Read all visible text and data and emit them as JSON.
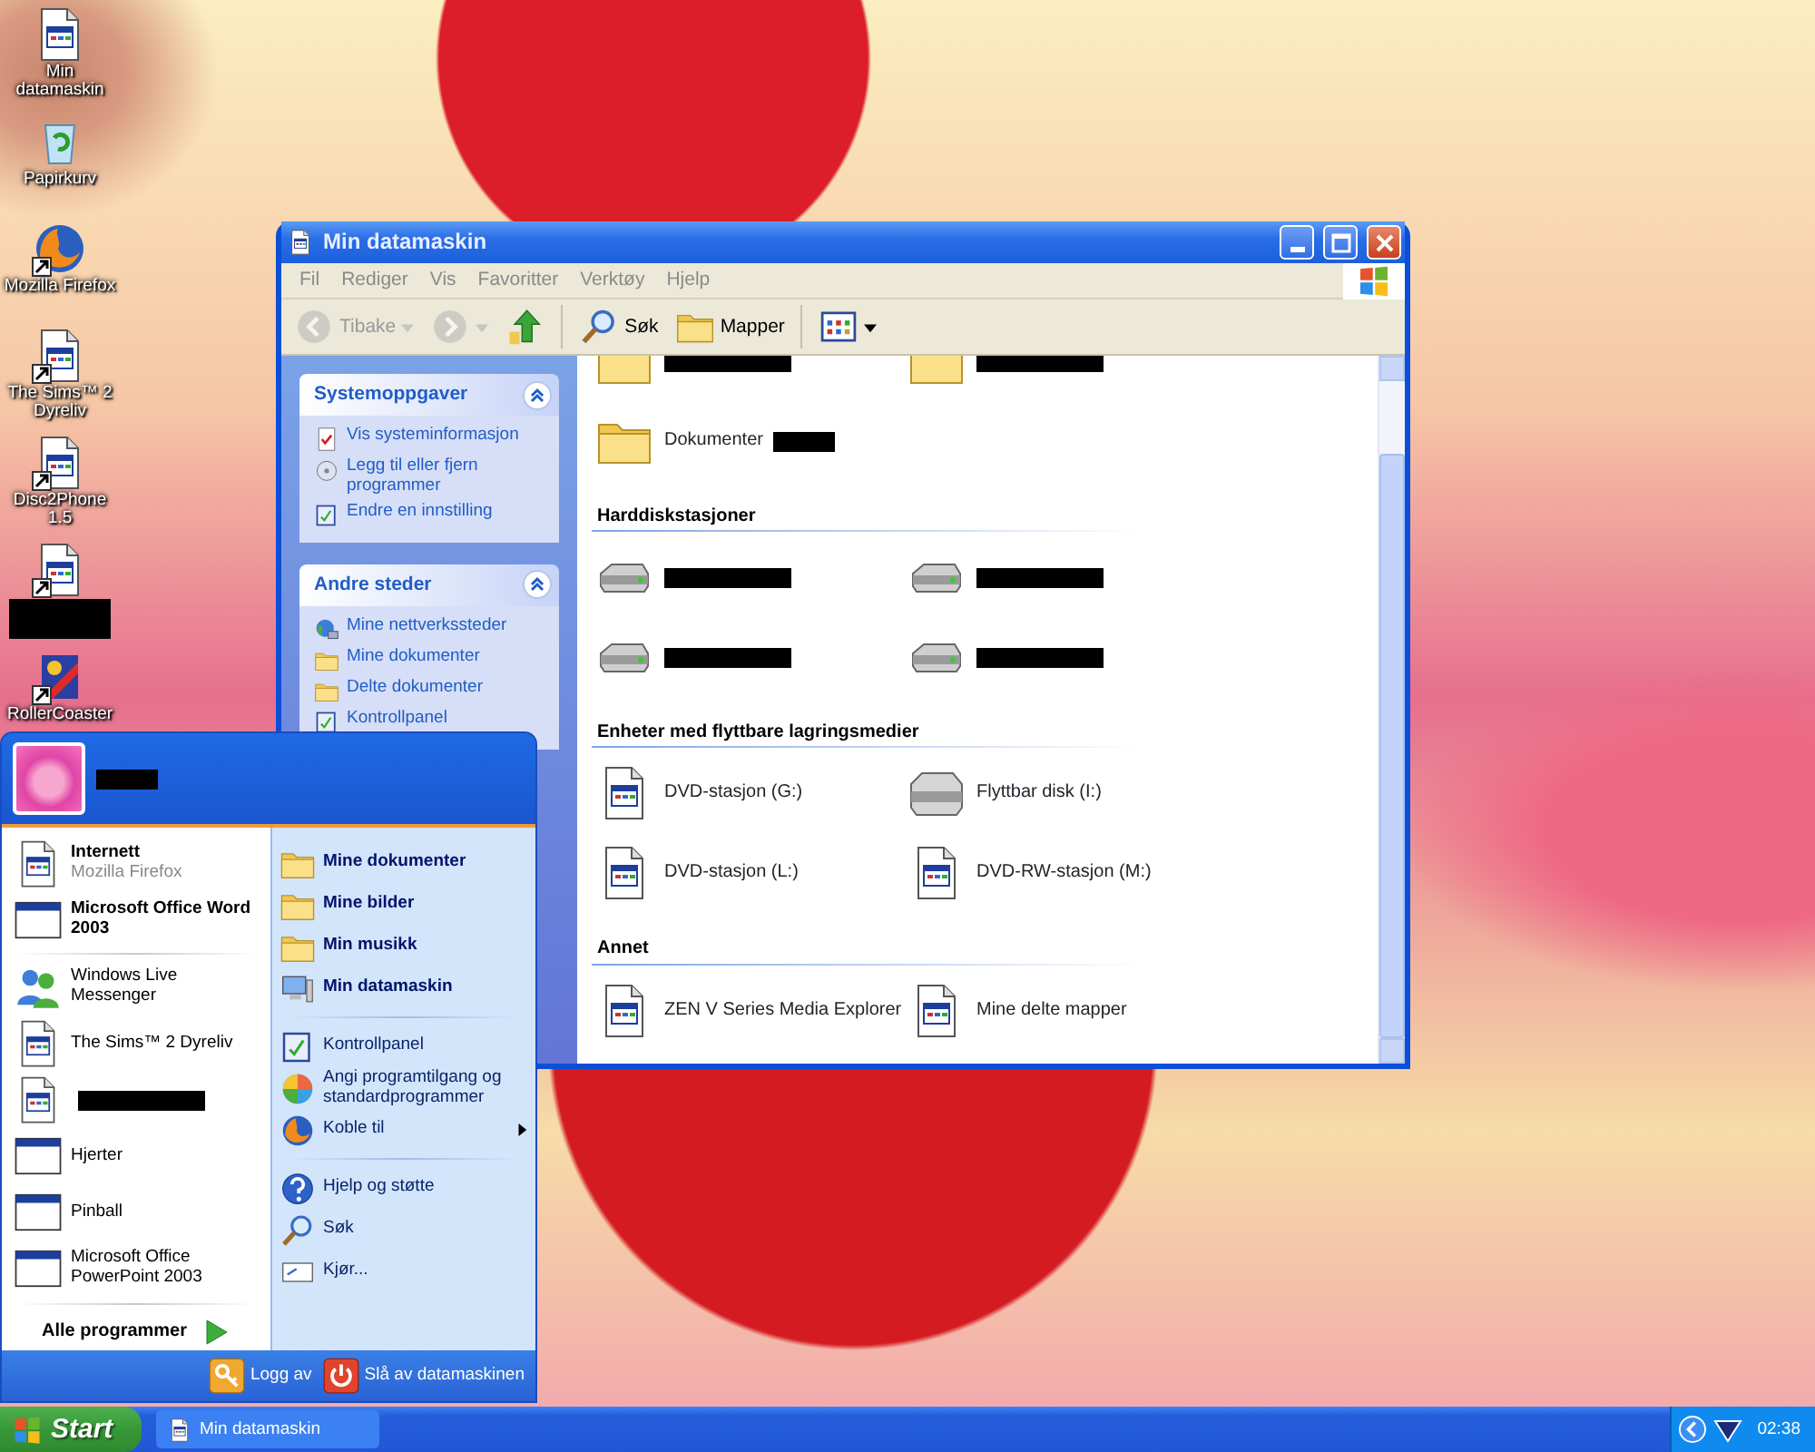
{
  "desktop_icons": [
    {
      "label": "Min datamaskin",
      "kind": "program",
      "shortcut": false
    },
    {
      "label": "Papirkurv",
      "kind": "recycle",
      "shortcut": false
    },
    {
      "label": "Mozilla Firefox",
      "kind": "firefox",
      "shortcut": true
    },
    {
      "label": "The Sims™ 2 Dyreliv",
      "kind": "program",
      "shortcut": true
    },
    {
      "label": "Disc2Phone 1.5",
      "kind": "program",
      "shortcut": true
    },
    {
      "kind": "program",
      "shortcut": true,
      "redacted": true
    },
    {
      "label": "RollerCoaster",
      "kind": "coaster",
      "shortcut": true
    }
  ],
  "window": {
    "title": "Min datamaskin",
    "menu": [
      "Fil",
      "Rediger",
      "Vis",
      "Favoritter",
      "Verktøy",
      "Hjelp"
    ],
    "toolbar": [
      {
        "kind": "back",
        "label": "Tibake",
        "disabled": true
      },
      {
        "kind": "forward",
        "disabled": true
      },
      {
        "kind": "up",
        "disabled": false
      },
      {
        "kind": "search",
        "label": "Søk",
        "disabled": false
      },
      {
        "kind": "folders",
        "label": "Mapper",
        "disabled": false
      },
      {
        "kind": "views",
        "disabled": false
      }
    ],
    "task_panels": [
      {
        "title": "Systemoppgaver",
        "expanded": true,
        "links": [
          {
            "kind": "info",
            "label": "Vis systeminformasjon"
          },
          {
            "kind": "disc",
            "label": "Legg til eller fjern programmer"
          },
          {
            "kind": "cpanel",
            "label": "Endre en innstilling"
          }
        ]
      },
      {
        "title": "Andre steder",
        "expanded": true,
        "links": [
          {
            "kind": "network",
            "label": "Mine nettverkssteder"
          },
          {
            "kind": "folder",
            "label": "Mine dokumenter"
          },
          {
            "kind": "folder",
            "label": "Delte dokumenter"
          },
          {
            "kind": "cpanel",
            "label": "Kontrollpanel"
          }
        ]
      }
    ],
    "sections": [
      {
        "items": [
          {
            "kind": "folder",
            "redacted": true
          },
          {
            "kind": "folder",
            "redacted": true
          },
          {
            "kind": "folder",
            "label": "Dokumenter",
            "redacted": true
          }
        ]
      },
      {
        "title": "Harddiskstasjoner",
        "items": [
          {
            "kind": "drive",
            "redacted": true
          },
          {
            "kind": "drive",
            "redacted": true
          },
          {
            "kind": "drive",
            "redacted": true
          },
          {
            "kind": "drive",
            "redacted": true
          }
        ]
      },
      {
        "title": "Enheter med flyttbare lagringsmedier",
        "items": [
          {
            "kind": "program",
            "label": "DVD-stasjon (G:)"
          },
          {
            "kind": "removable",
            "label": "Flyttbar disk (I:)"
          },
          {
            "kind": "program",
            "label": "DVD-stasjon (L:)"
          },
          {
            "kind": "program",
            "label": "DVD-RW-stasjon (M:)"
          }
        ]
      },
      {
        "title": "Annet",
        "items": [
          {
            "kind": "program",
            "label": "ZEN V Series Media Explorer"
          },
          {
            "kind": "program",
            "label": "Mine delte mapper"
          }
        ]
      }
    ]
  },
  "start_menu": {
    "user": {
      "redacted": true
    },
    "pinned": [
      {
        "kind": "program",
        "label": "Internett",
        "subtitle": "Mozilla Firefox"
      },
      {
        "kind": "window",
        "label": "Microsoft Office Word 2003"
      }
    ],
    "recent": [
      {
        "kind": "messenger",
        "label": "Windows Live Messenger"
      },
      {
        "kind": "program",
        "label": "The Sims™ 2 Dyreliv"
      },
      {
        "kind": "program",
        "redacted": true
      },
      {
        "kind": "window",
        "label": "Hjerter"
      },
      {
        "kind": "window",
        "label": "Pinball"
      },
      {
        "kind": "window",
        "label": "Microsoft Office PowerPoint 2003"
      }
    ],
    "all_programs": "Alle programmer",
    "places": [
      [
        {
          "kind": "mydocs",
          "label": "Mine dokumenter",
          "bold": true
        },
        {
          "kind": "pictures",
          "label": "Mine bilder",
          "bold": true
        },
        {
          "kind": "music",
          "label": "Min musikk",
          "bold": true
        },
        {
          "kind": "computer",
          "label": "Min datamaskin",
          "bold": true
        }
      ],
      [
        {
          "kind": "cpanel",
          "label": "Kontrollpanel",
          "bold": false
        },
        {
          "kind": "access",
          "label": "Angi programtilgang og standardprogrammer",
          "bold": false
        },
        {
          "kind": "connect",
          "label": "Koble til",
          "bold": false,
          "submenu": true
        }
      ],
      [
        {
          "kind": "help",
          "label": "Hjelp og støtte",
          "bold": false
        },
        {
          "kind": "search",
          "label": "Søk",
          "bold": false
        },
        {
          "kind": "run",
          "label": "Kjør...",
          "bold": false
        }
      ]
    ],
    "footer": [
      {
        "kind": "logoff",
        "label": "Logg av"
      },
      {
        "kind": "shutdown",
        "label": "Slå av datamaskinen"
      }
    ]
  },
  "taskbar": {
    "start": "Start",
    "tasks": [
      {
        "label": "Min datamaskin",
        "selected": false
      }
    ],
    "clock": "02:38"
  }
}
